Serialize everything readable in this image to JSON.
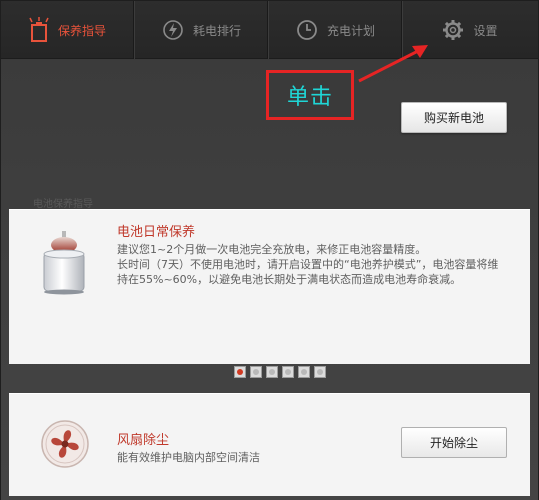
{
  "tabs": [
    {
      "label": "保养指导",
      "icon": "battery-maintenance-icon",
      "active": true
    },
    {
      "label": "耗电排行",
      "icon": "power-ranking-icon",
      "active": false
    },
    {
      "label": "充电计划",
      "icon": "clock-icon",
      "active": false
    },
    {
      "label": "设置",
      "icon": "gear-icon",
      "active": false
    }
  ],
  "annotation": {
    "text": "单击"
  },
  "buy_button": {
    "label": "购买新电池"
  },
  "section_label": "电池保养指导",
  "battery_card": {
    "title": "电池日常保养",
    "lines": [
      "建议您1~2个月做一次电池完全充放电，来修正电池容量精度。",
      "长时间（7天）不使用电池时，请开启设置中的“电池养护模式”，电池容量将维持在55%~60%，以避免电池长期处于满电状态而造成电池寿命衰减。"
    ]
  },
  "pager": {
    "count": 6,
    "active_index": 0
  },
  "fan_card": {
    "title": "风扇除尘",
    "subtitle": "能有效维护电脑内部空间清洁",
    "button": "开始除尘"
  },
  "colors": {
    "accent": "#e8533b",
    "annotation_border": "#e62424",
    "annotation_text": "#1fd6d6",
    "title_red": "#c0392b"
  }
}
